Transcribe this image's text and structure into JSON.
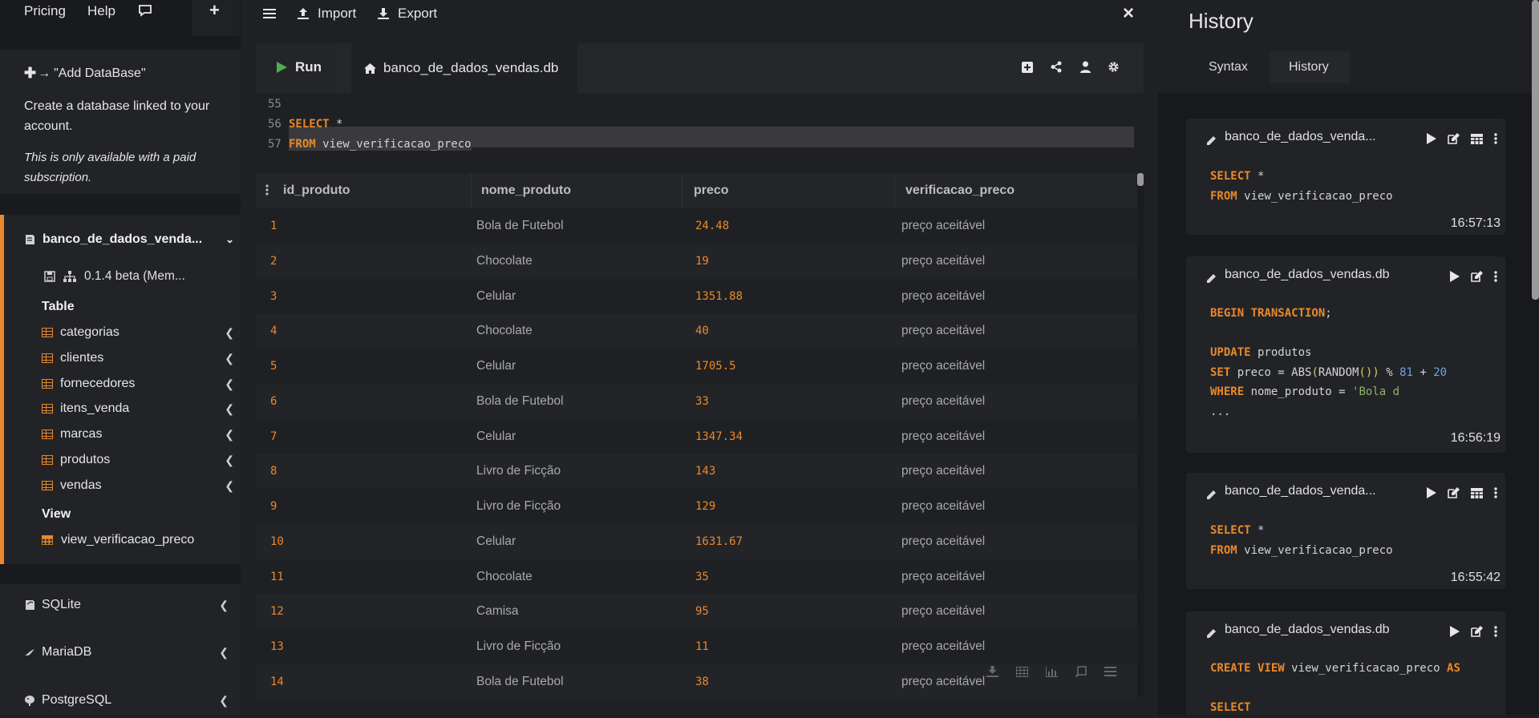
{
  "left": {
    "top": {
      "pricing": "Pricing",
      "help": "Help",
      "plus": "+"
    },
    "add_db": {
      "title": "\"Add DataBase\"",
      "desc_line1": "Create a database linked to your",
      "desc_line2": "account.",
      "note_line1": "This is only available with a paid",
      "note_line2": "subscription."
    },
    "db": {
      "name": "banco_de_dados_venda...",
      "version": "0.1.4 beta (Mem...",
      "table_heading": "Table",
      "tables": [
        "categorias",
        "clientes",
        "fornecedores",
        "itens_venda",
        "marcas",
        "produtos",
        "vendas"
      ],
      "view_heading": "View",
      "views": [
        "view_verificacao_preco"
      ]
    },
    "engines": [
      "SQLite",
      "MariaDB",
      "PostgreSQL"
    ]
  },
  "toolbar": {
    "import": "Import",
    "export": "Export",
    "close": "×"
  },
  "tabs": {
    "run": "Run",
    "file": "banco_de_dados_vendas.db"
  },
  "editor": {
    "lines": [
      {
        "num": "55",
        "kw": "",
        "rest": ""
      },
      {
        "num": "56",
        "kw": "SELECT",
        "rest": " *"
      },
      {
        "num": "57",
        "kw": "FROM",
        "rest": " view_verificacao_preco"
      }
    ]
  },
  "grid": {
    "columns": [
      "id_produto",
      "nome_produto",
      "preco",
      "verificacao_preco"
    ],
    "rows": [
      [
        "1",
        "Bola de Futebol",
        "24.48",
        "preço aceitável"
      ],
      [
        "2",
        "Chocolate",
        "19",
        "preço aceitável"
      ],
      [
        "3",
        "Celular",
        "1351.88",
        "preço aceitável"
      ],
      [
        "4",
        "Chocolate",
        "40",
        "preço aceitável"
      ],
      [
        "5",
        "Celular",
        "1705.5",
        "preço aceitável"
      ],
      [
        "6",
        "Bola de Futebol",
        "33",
        "preço aceitável"
      ],
      [
        "7",
        "Celular",
        "1347.34",
        "preço aceitável"
      ],
      [
        "8",
        "Livro de Ficção",
        "143",
        "preço aceitável"
      ],
      [
        "9",
        "Livro de Ficção",
        "129",
        "preço aceitável"
      ],
      [
        "10",
        "Celular",
        "1631.67",
        "preço aceitável"
      ],
      [
        "11",
        "Chocolate",
        "35",
        "preço aceitável"
      ],
      [
        "12",
        "Camisa",
        "95",
        "preço aceitável"
      ],
      [
        "13",
        "Livro de Ficção",
        "11",
        "preço aceitável"
      ],
      [
        "14",
        "Bola de Futebol",
        "38",
        "preço aceitável"
      ]
    ]
  },
  "history": {
    "title": "History",
    "tabs": [
      "Syntax",
      "History"
    ],
    "items": [
      {
        "db": "banco_de_dados_venda...",
        "time": "16:57:13"
      },
      {
        "db": "banco_de_dados_vendas.db",
        "time": "16:56:19"
      },
      {
        "db": "banco_de_dados_venda...",
        "time": "16:55:42"
      },
      {
        "db": "banco_de_dados_vendas.db",
        "time": ""
      }
    ],
    "code1": {
      "l1kw": "SELECT",
      "l1": " *",
      "l2kw": "FROM",
      "l2": " view_verificacao_preco"
    },
    "code2": {
      "l1kw": "BEGIN TRANSACTION",
      "l1": ";",
      "l3kw": "UPDATE",
      "l3": " produtos",
      "l4kw": "SET",
      "l4a": " preco = ABS",
      "l4p1": "(",
      "l4b": "RANDOM",
      "l4p2": "())",
      "l4c": " % ",
      "l4n1": "81",
      "l4d": " + ",
      "l4n2": "20",
      "l5kw": "WHERE",
      "l5a": " nome_produto = ",
      "l5s": "'Bola d",
      "l6": "..."
    },
    "code3": {
      "l1kw": "SELECT",
      "l1": " *",
      "l2kw": "FROM",
      "l2": " view_verificacao_preco"
    },
    "code4": {
      "l1kw": "CREATE VIEW",
      "l1": " view_verificacao_preco ",
      "l1kw2": "AS",
      "l3kw": "SELECT"
    }
  }
}
